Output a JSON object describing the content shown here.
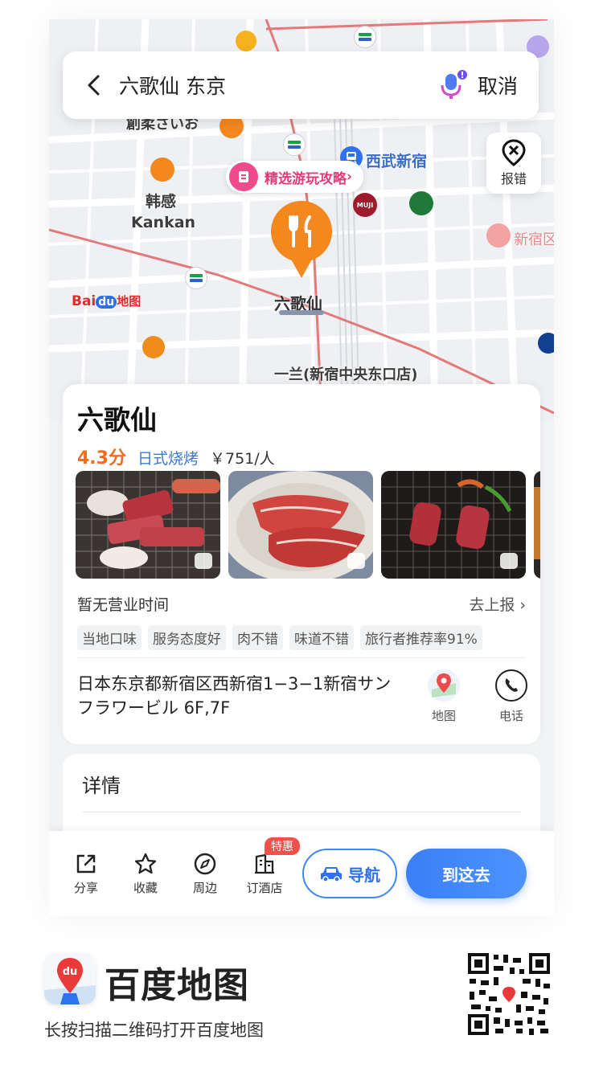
{
  "search": {
    "query": "六歌仙 东京",
    "cancel_label": "取消"
  },
  "map": {
    "report_label": "报错",
    "guide_chip": "精选游玩攻略",
    "station_label": "西武新宿",
    "place_kankan_cn": "韩感",
    "place_kankan_en": "Kankan",
    "place_partial_jp": "創柔さいお",
    "place_shinjuku": "新宿区",
    "place_ichiran": "一兰(新宿中央东口店)",
    "place_muji": "MUJI",
    "pin_label": "六歌仙",
    "logo_bai": "Bai",
    "logo_du": "du",
    "logo_map": "地图"
  },
  "poi": {
    "name": "六歌仙",
    "rating": "4.3分",
    "cuisine": "日式烧烤",
    "price": "￥751/人",
    "hours": "暂无营业时间",
    "report_link": "去上报",
    "tags": [
      "当地口味",
      "服务态度好",
      "肉不错",
      "味道不错",
      "旅行者推荐率91%"
    ],
    "address": "日本东京都新宿区西新宿1−3−1新宿サンフラワービル 6F,7F",
    "map_label": "地图",
    "phone_label": "电话"
  },
  "details": {
    "title": "详情"
  },
  "toolbar": {
    "share": "分享",
    "favorite": "收藏",
    "nearby": "周边",
    "hotel": "订酒店",
    "hotel_badge": "特惠",
    "navigate": "导航",
    "go_here": "到这去"
  },
  "footer": {
    "brand": "百度地图",
    "hint": "长按扫描二维码打开百度地图",
    "logo_text": "du"
  },
  "colors": {
    "accent_blue": "#3a7ff6",
    "rating_orange": "#f26b1d",
    "pin_orange": "#f5871f",
    "badge_red": "#f2504a"
  }
}
